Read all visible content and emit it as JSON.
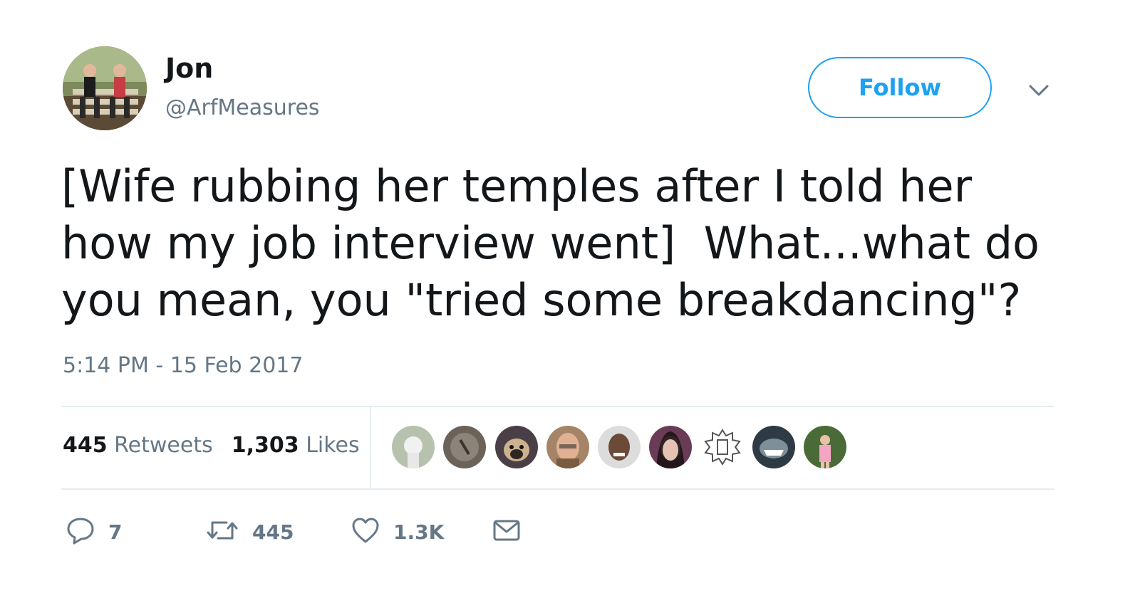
{
  "author": {
    "display_name": "Jon",
    "handle": "@ArfMeasures"
  },
  "follow_button_label": "Follow",
  "tweet": {
    "text": "[Wife rubbing her temples after I told her how my job interview went]  What...what do you mean, you \"tried some breakdancing\"?",
    "timestamp": "5:14 PM - 15 Feb 2017"
  },
  "stats": {
    "retweets_count": "445",
    "retweets_label": "Retweets",
    "likes_count": "1,303",
    "likes_label": "Likes"
  },
  "actions": {
    "reply_count": "7",
    "retweet_count": "445",
    "like_count": "1.3K"
  },
  "icons": {
    "reply": "reply-icon",
    "retweet": "retweet-icon",
    "like": "heart-icon",
    "dm": "envelope-icon",
    "caret": "chevron-down-icon"
  },
  "colors": {
    "accent": "#1da1f2",
    "text": "#14171a",
    "muted": "#657786",
    "divider": "#e6ecf0"
  }
}
